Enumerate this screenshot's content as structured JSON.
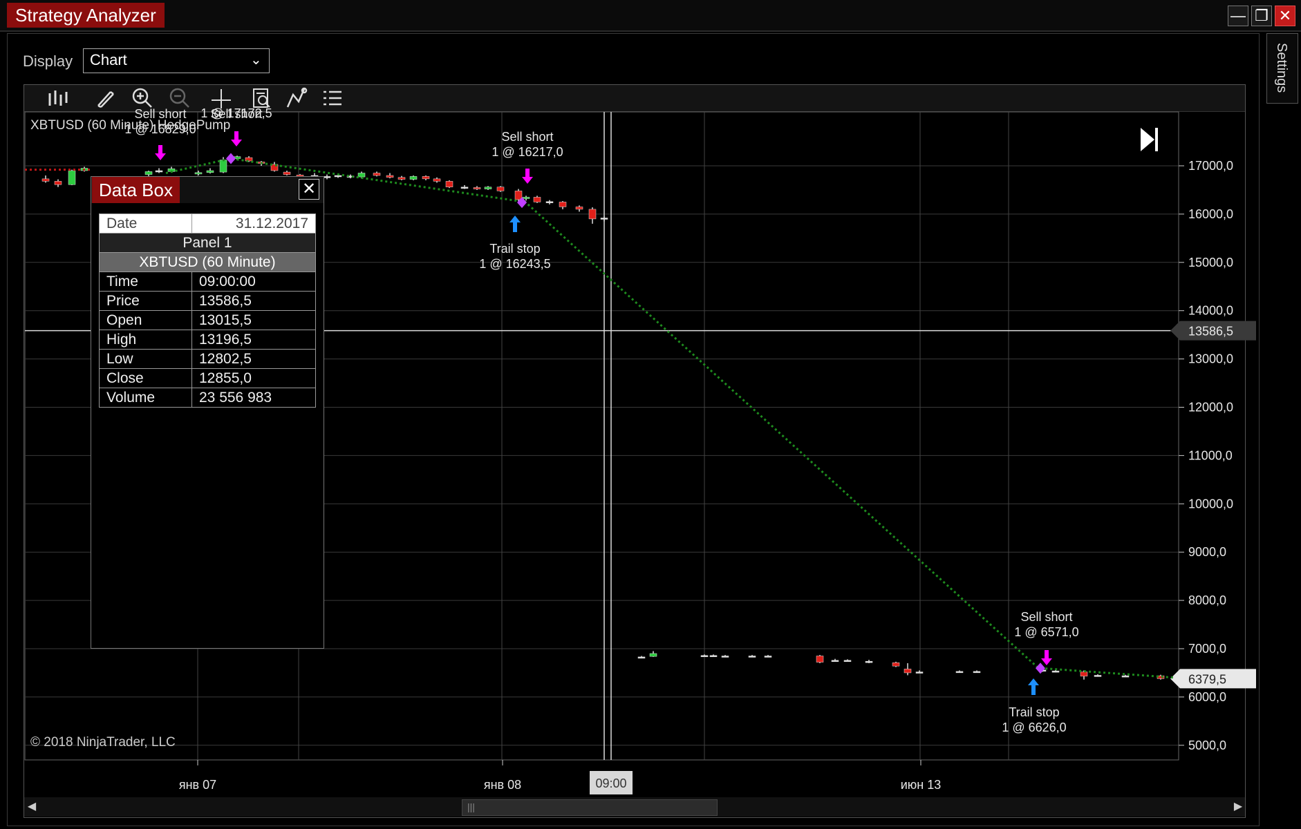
{
  "window": {
    "title": "Strategy Analyzer",
    "buttons": {
      "minimize": "—",
      "restore": "❐",
      "close": "✕"
    },
    "settings_tab": "Settings"
  },
  "display": {
    "label": "Display",
    "value": "Chart"
  },
  "toolbar": {
    "icons": [
      "bar-type-icon",
      "pencil-icon",
      "zoom-in-icon",
      "zoom-out-icon",
      "crosshair-icon",
      "data-box-icon",
      "strategy-icon",
      "properties-icon"
    ]
  },
  "chart": {
    "series_label": "XBTUSD (60 Minute) HedgePump",
    "copyright": "© 2018 NinjaTrader, LLC",
    "crosshair_time": "09:00",
    "crosshair_price": "13586,5",
    "last_price": "6379,5",
    "colors": {
      "up": "#2ecc40",
      "down": "#e0201a",
      "background": "#000000",
      "grid": "#d0d0d0",
      "trade_line": "#1e8b1e",
      "signal_arrow": "#ff00ff",
      "exit_arrow": "#1e90ff"
    }
  },
  "chart_data": {
    "type": "candlestick",
    "title": "XBTUSD (60 Minute) HedgePump",
    "ylim": [
      4500,
      18000
    ],
    "y_ticks": [
      "17000,0",
      "16000,0",
      "15000,0",
      "14000,0",
      "13000,0",
      "12000,0",
      "11000,0",
      "10000,0",
      "9000,0",
      "8000,0",
      "7000,0",
      "6000,0",
      "5000,0"
    ],
    "x_ticks": [
      "янв 07",
      "янв 08",
      "июн 13"
    ],
    "price_markers": [
      "13586,5",
      "6379,5"
    ],
    "annotations": [
      {
        "type": "entry",
        "label": "Sell short",
        "detail": "1 @ 16829,0"
      },
      {
        "type": "entry",
        "label": "Sell short",
        "detail": "1 @ 17172,5"
      },
      {
        "type": "entry",
        "label": "Sell short",
        "detail": "1 @ 16217,0"
      },
      {
        "type": "exit",
        "label": "Trail stop",
        "detail": "1 @ 16243,5"
      },
      {
        "type": "entry",
        "label": "Sell short",
        "detail": "1 @ 6571,0"
      },
      {
        "type": "exit",
        "label": "Trail stop",
        "detail": "1 @ 6626,0"
      }
    ]
  },
  "databox": {
    "title": "Data Box",
    "date_label": "Date",
    "date_value": "31.12.2017",
    "panel": "Panel 1",
    "series": "XBTUSD (60 Minute)",
    "rows": [
      {
        "label": "Time",
        "value": "09:00:00"
      },
      {
        "label": "Price",
        "value": "13586,5"
      },
      {
        "label": "Open",
        "value": "13015,5"
      },
      {
        "label": "High",
        "value": "13196,5"
      },
      {
        "label": "Low",
        "value": "12802,5"
      },
      {
        "label": "Close",
        "value": "12855,0"
      },
      {
        "label": "Volume",
        "value": "23 556 983"
      }
    ]
  }
}
